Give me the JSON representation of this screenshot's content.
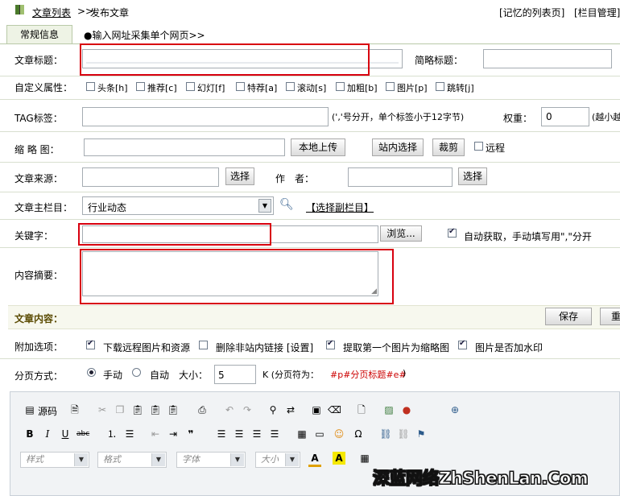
{
  "header": {
    "breadcrumb_link": "文章列表",
    "breadcrumb_sep": ">>",
    "breadcrumb_current": "发布文章",
    "remember_list": "[记忆的列表页]",
    "column_manage": "[栏目管理]"
  },
  "tabs": [
    {
      "label": "常规信息"
    },
    {
      "label": "●输入网址采集单个网页>>"
    }
  ],
  "form": {
    "title_label": "文章标题：",
    "short_title_label": "简略标题：",
    "custom_attr_label": "自定义属性：",
    "flags": [
      {
        "label": "头条[h]",
        "checked": false
      },
      {
        "label": "推荐[c]",
        "checked": false
      },
      {
        "label": "幻灯[f]",
        "checked": false
      },
      {
        "label": "特荐[a]",
        "checked": false
      },
      {
        "label": "滚动[s]",
        "checked": false
      },
      {
        "label": "加粗[b]",
        "checked": false
      },
      {
        "label": "图片[p]",
        "checked": false
      },
      {
        "label": "跳转[j]",
        "checked": false
      }
    ],
    "tag_label": "TAG标签：",
    "tag_hint": "(','号分开，单个标签小于12字节)",
    "weight_label": "权重：",
    "weight_value": "0",
    "weight_hint": "(越小越",
    "thumb_label": "缩 略 图：",
    "local_upload": "本地上传",
    "site_select": "站内选择",
    "crop": "裁剪",
    "remote_label": "远程",
    "source_label": "文章来源：",
    "select_btn": "选择",
    "author_label": "作　者：",
    "author_select": "选择",
    "main_column_label": "文章主栏目：",
    "main_column_value": "行业动态",
    "sub_column_link": "【选择副栏目】",
    "keywords_label": "关键字：",
    "browse_btn": "浏览...",
    "auto_keywords": "自动获取，手动填写用\",\"分开",
    "auto_keywords_checked": true,
    "summary_label": "内容摘要：",
    "content_label": "文章内容：",
    "save_btn": "保存",
    "reset_btn": "重",
    "extra_label": "附加选项：",
    "extra_options": [
      {
        "label": "下载远程图片和资源",
        "checked": true
      },
      {
        "label": "删除非站内链接 [设置]",
        "checked": false
      },
      {
        "label": "提取第一个图片为缩略图",
        "checked": true
      },
      {
        "label": "图片是否加水印",
        "checked": true
      }
    ],
    "paging_label": "分页方式：",
    "paging_manual": "手动",
    "paging_auto": "自动",
    "size_label": "大小：",
    "size_value": "5",
    "size_unit": "K (分页符为：",
    "page_marker": "#p#分页标题#e#",
    "page_marker_close": ")"
  },
  "editor": {
    "source_label": "源码",
    "style_combo": "样式",
    "format_combo": "格式",
    "font_combo": "字体",
    "size_combo": "大小"
  },
  "watermark": "深蓝网络ZhShenLan.Com",
  "colors": {
    "accent_red": "#d8000f",
    "section_bg": "#f7f8ee",
    "link_red": "#cc0000"
  }
}
